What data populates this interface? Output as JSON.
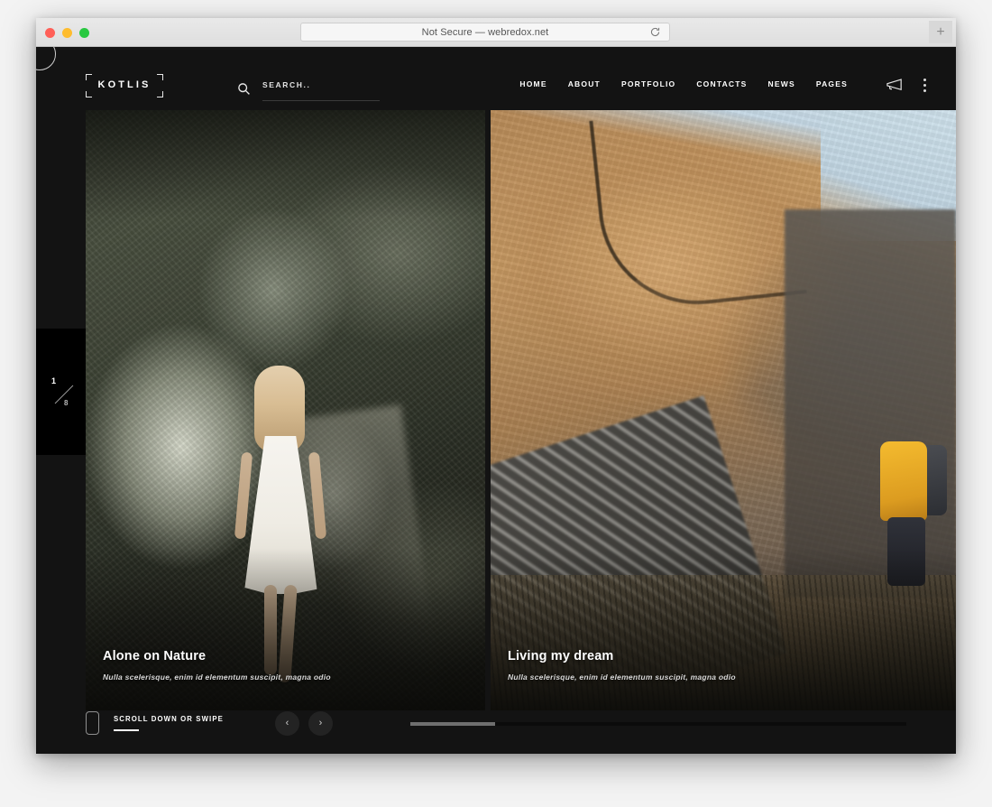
{
  "browser": {
    "url_text": "Not Secure — webredox.net",
    "reload_label": "↻",
    "new_tab_label": "+",
    "traffic_lights": [
      "close",
      "minimize",
      "maximize"
    ]
  },
  "site": {
    "logo": {
      "text": "KOTLIS"
    },
    "search": {
      "placeholder": "SEARCH..",
      "value": "",
      "icon": "search-icon"
    },
    "nav": {
      "items": [
        {
          "label": "HOME"
        },
        {
          "label": "ABOUT"
        },
        {
          "label": "PORTFOLIO"
        },
        {
          "label": "CONTACTS"
        },
        {
          "label": "NEWS"
        },
        {
          "label": "PAGES"
        }
      ]
    },
    "header_tools": [
      {
        "icon": "megaphone-icon"
      },
      {
        "icon": "kebab-menu-icon"
      }
    ],
    "counter": {
      "current": "1",
      "total": "8"
    },
    "slides": [
      {
        "title": "Alone on Nature",
        "subtitle": "Nulla scelerisque, enim id elementum suscipit, magna odio"
      },
      {
        "title": "Living my dream",
        "subtitle": "Nulla scelerisque, enim id elementum suscipit, magna odio"
      }
    ],
    "bottom_bar": {
      "scroll_hint": "SCROLL DOWN OR SWIPE",
      "prev_label": "‹",
      "next_label": "›",
      "progress_percent": 17
    },
    "colors": {
      "page_background": "#131313",
      "text_primary": "#ffffff",
      "text_muted": "#d9d9d9",
      "progress_fill": "#6f6f6f",
      "progress_track": "#0b0b0b"
    }
  }
}
